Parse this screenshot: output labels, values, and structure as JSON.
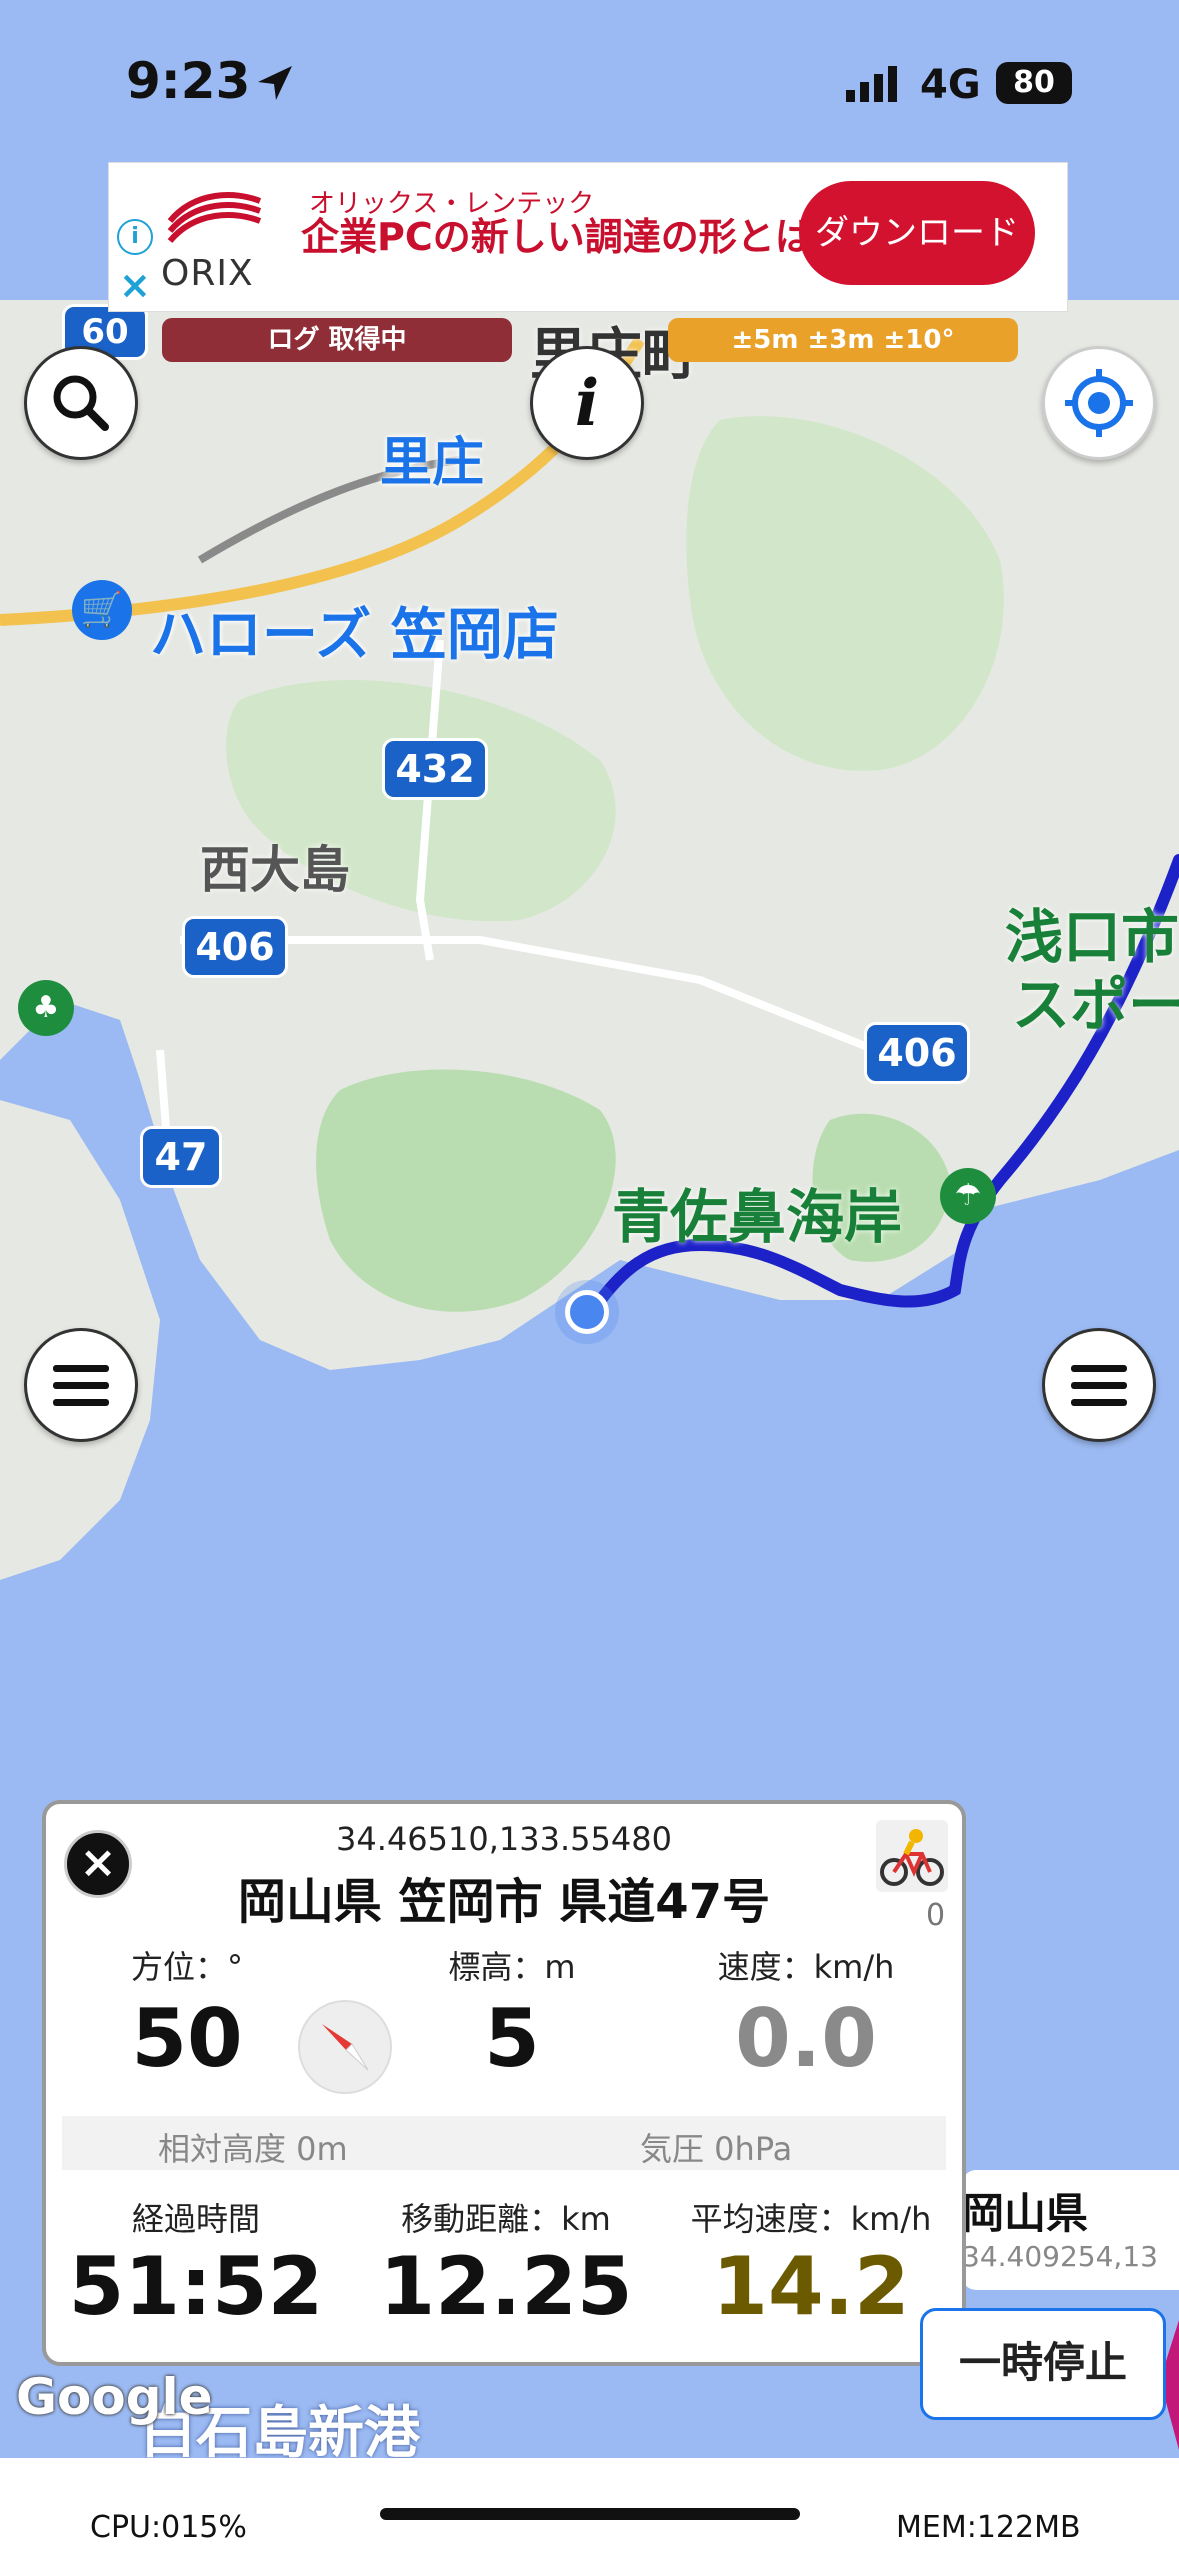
{
  "status_bar": {
    "time": "9:23",
    "network": "4G",
    "battery": "80"
  },
  "ad": {
    "brand": "オリックス・レンテック",
    "headline": "企業PCの新しい調達の形とは？",
    "logo": "ORIX",
    "cta": "ダウンロード",
    "info_icon": "i",
    "close_icon": "×"
  },
  "top_pills": {
    "logging": "ログ 取得中",
    "accuracy": "±5m ±3m ±10°"
  },
  "map_labels": {
    "town1": "里庄",
    "town1_big": "里庄町",
    "store": "ハローズ 笠岡店",
    "island": "西大島",
    "coast": "青佐鼻海岸",
    "park": "浅口市",
    "park2": "スポー",
    "port": "白石島新港",
    "route_432": "432",
    "route_406a": "406",
    "route_406b": "406",
    "route_47": "47",
    "route_60": "60"
  },
  "panel": {
    "coords": "34.46510,133.55480",
    "address": "岡山県 笠岡市 県道47号",
    "count": "0",
    "heading_label": "方位：°",
    "heading_value": "50",
    "altitude_label": "標高：m",
    "altitude_value": "5",
    "speed_label": "速度：km/h",
    "speed_value": "0.0",
    "rel_alt": "相対高度 0m",
    "pressure": "気圧 0hPa",
    "elapsed_label": "経過時間",
    "elapsed_value": "51:52",
    "distance_label": "移動距離：km",
    "distance_value": "12.25",
    "avg_label": "平均速度：km/h",
    "avg_value": "14.2"
  },
  "pause_button": "一時停止",
  "pref_card": {
    "name": "岡山県",
    "coords": "34.409254,13"
  },
  "google": "Google",
  "footer": {
    "cpu": "CPU:015%",
    "mem": "MEM:122MB"
  },
  "colors": {
    "route": "#1c22c8",
    "water": "#9bb9f2",
    "land": "#e4e7e1",
    "accent": "#1a73e8",
    "avg_speed": "#6b5a00"
  }
}
